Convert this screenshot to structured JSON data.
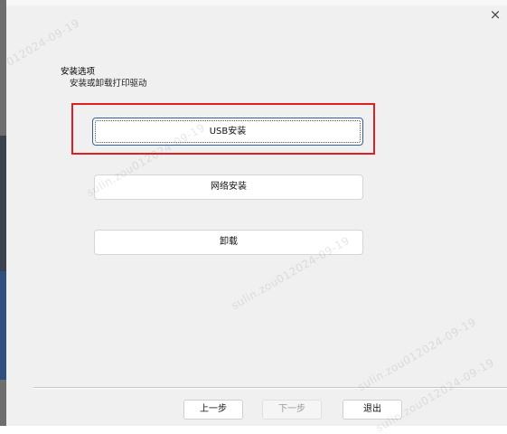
{
  "window": {
    "close_glyph": "×"
  },
  "header": {
    "title": "安装选项",
    "subtitle": "安装或卸载打印驱动"
  },
  "options": {
    "usb": "USB安装",
    "network": "网络安装",
    "uninstall": "卸载"
  },
  "nav": {
    "prev": "上一步",
    "next": "下一步",
    "exit": "退出"
  },
  "watermark": {
    "w1": "012024-09-19",
    "w2": "sulin.zou012024-09-19",
    "w3": "sulin.zou012024-09-19",
    "w4": "sulin.zou012024-09-19",
    "w5": "sulin.zou012024-09-19"
  },
  "colors": {
    "highlight": "#e02020",
    "focus_border": "#2f5f9f",
    "background": "#f0f0f0"
  }
}
